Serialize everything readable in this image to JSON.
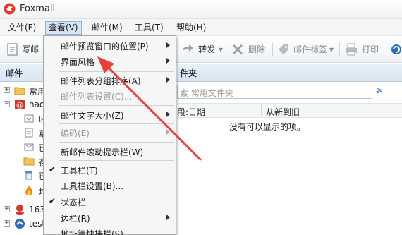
{
  "window": {
    "title": "Foxmail"
  },
  "menubar": {
    "items": [
      {
        "label": "文件(F)"
      },
      {
        "label": "查看(V)"
      },
      {
        "label": "邮件(M)"
      },
      {
        "label": "工具(T)"
      },
      {
        "label": "帮助(H)"
      }
    ]
  },
  "toolbar": {
    "compose": "写邮",
    "forward": "转发",
    "delete": "删除",
    "tag": "邮件标签",
    "print": "打印"
  },
  "left_panel": {
    "header": "邮件",
    "items": [
      {
        "label": "常用"
      },
      {
        "label": "hao"
      },
      {
        "label": "收"
      },
      {
        "label": "草"
      },
      {
        "label": "已"
      },
      {
        "label": "存"
      },
      {
        "label": "已"
      },
      {
        "label": "垃"
      },
      {
        "label": "163"
      },
      {
        "label": "test"
      }
    ]
  },
  "right_panel": {
    "header": "件夹",
    "search_placeholder": "索 常用文件夹",
    "columns": {
      "sort_field": "段:日期",
      "order": "从新到旧"
    },
    "empty_message": "没有可以显示的项。"
  },
  "view_menu": {
    "items": [
      {
        "label": "邮件预览窗口的位置(P)"
      },
      {
        "label": "界面风格"
      },
      {
        "label": "邮件列表分组排序(A)"
      },
      {
        "label": "邮件列表设置(C)..."
      },
      {
        "label": "邮件文字大小(Z)"
      },
      {
        "label": "编码(E)"
      },
      {
        "label": "新邮件滚动提示栏(W)"
      },
      {
        "label": "工具栏(T)"
      },
      {
        "label": "工具栏设置(B)..."
      },
      {
        "label": "状态栏"
      },
      {
        "label": "边栏(R)"
      },
      {
        "label": "地址簿快捷栏(S)"
      }
    ]
  },
  "colors": {
    "accent": "#2d6db5",
    "arrow": "#e8413c",
    "menu_bg": "#f6f6f6"
  }
}
